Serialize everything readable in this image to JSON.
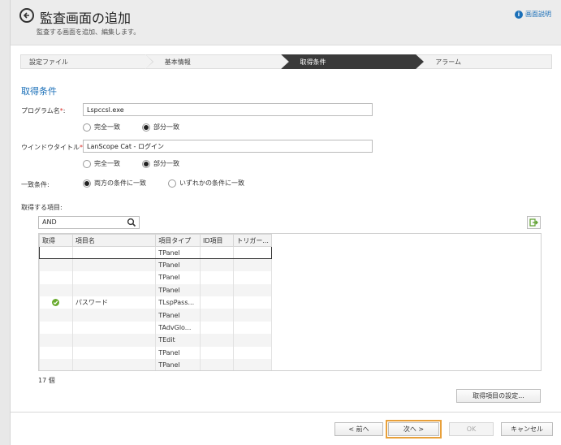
{
  "header": {
    "title": "監査画面の追加",
    "subtitle": "監査する画面を追加、編集します。",
    "help_label": "画面説明"
  },
  "steps": [
    {
      "label": "設定ファイル",
      "active": false
    },
    {
      "label": "基本情報",
      "active": false
    },
    {
      "label": "取得条件",
      "active": true
    },
    {
      "label": "アラーム",
      "active": false
    }
  ],
  "section_title": "取得条件",
  "program": {
    "label": "プログラム名",
    "required_mark": "*",
    "colon": ":",
    "value": "Lspccsl.exe",
    "opt_exact": "完全一致",
    "opt_partial": "部分一致"
  },
  "window_title": {
    "label": "ウインドウタイトル",
    "required_mark": "*",
    "colon": ":",
    "value": "LanScope Cat - ログイン",
    "opt_exact": "完全一致",
    "opt_partial": "部分一致"
  },
  "match_condition": {
    "label": "一致条件:",
    "opt_both": "両方の条件に一致",
    "opt_either": "いずれかの条件に一致"
  },
  "items": {
    "label": "取得する項目:",
    "search_value": "AND",
    "columns": [
      "取得",
      "項目名",
      "項目タイプ",
      "ID項目",
      "トリガー..."
    ],
    "rows": [
      {
        "checked": false,
        "name": "",
        "type": "TPanel",
        "id": "",
        "trigger": ""
      },
      {
        "checked": false,
        "name": "",
        "type": "TPanel",
        "id": "",
        "trigger": ""
      },
      {
        "checked": false,
        "name": "",
        "type": "TPanel",
        "id": "",
        "trigger": ""
      },
      {
        "checked": false,
        "name": "",
        "type": "TPanel",
        "id": "",
        "trigger": ""
      },
      {
        "checked": true,
        "name": "パスワード",
        "type": "TLspPass...",
        "id": "",
        "trigger": ""
      },
      {
        "checked": false,
        "name": "",
        "type": "TPanel",
        "id": "",
        "trigger": ""
      },
      {
        "checked": false,
        "name": "",
        "type": "TAdvGlo...",
        "id": "",
        "trigger": ""
      },
      {
        "checked": false,
        "name": "",
        "type": "TEdit",
        "id": "",
        "trigger": ""
      },
      {
        "checked": false,
        "name": "",
        "type": "TPanel",
        "id": "",
        "trigger": ""
      },
      {
        "checked": false,
        "name": "",
        "type": "TPanel",
        "id": "",
        "trigger": ""
      }
    ],
    "count": "17 個",
    "settings_button": "取得項目の設定..."
  },
  "footer": {
    "prev": "< 前へ",
    "next": "次へ >",
    "ok": "OK",
    "cancel": "キャンセル"
  },
  "colors": {
    "accent": "#1a6fb8",
    "required": "#d9302a",
    "active_step": "#3a3a3a",
    "check": "#6aab2f",
    "highlight": "#e8a03a"
  }
}
